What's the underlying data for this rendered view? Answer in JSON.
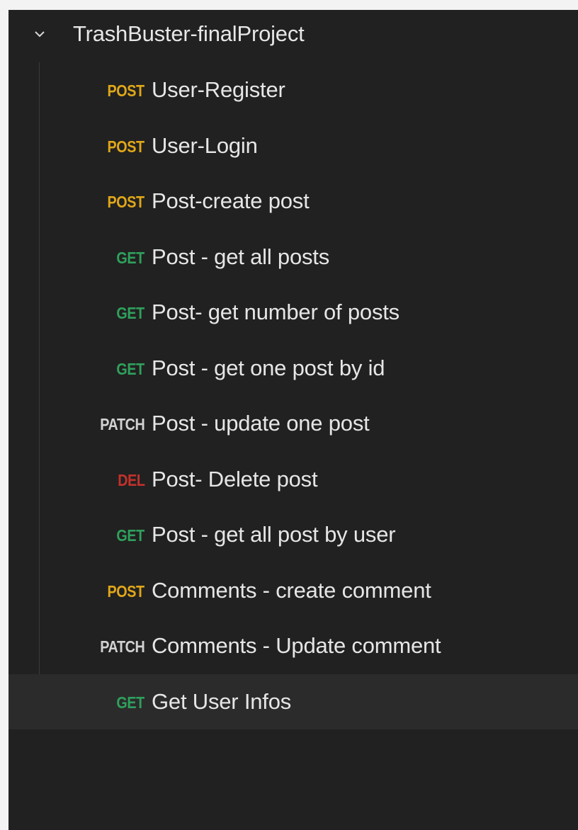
{
  "collection": {
    "name": "TrashBuster-finalProject",
    "expand_icon": "chevron-down-icon"
  },
  "requests": [
    {
      "method": "POST",
      "name": "User-Register"
    },
    {
      "method": "POST",
      "name": "User-Login"
    },
    {
      "method": "POST",
      "name": "Post-create post"
    },
    {
      "method": "GET",
      "name": "Post - get all posts"
    },
    {
      "method": "GET",
      "name": "Post- get number of posts"
    },
    {
      "method": "GET",
      "name": "Post - get one post by id"
    },
    {
      "method": "PATCH",
      "name": "Post - update one post"
    },
    {
      "method": "DEL",
      "name": "Post- Delete post"
    },
    {
      "method": "GET",
      "name": "Post - get all post by user"
    },
    {
      "method": "POST",
      "name": "Comments - create comment"
    },
    {
      "method": "PATCH",
      "name": "Comments - Update comment"
    },
    {
      "method": "GET",
      "name": "Get User Infos",
      "selected": true
    }
  ],
  "colors": {
    "background": "#212121",
    "text": "#e6e6e6",
    "post": "#e0a719",
    "get": "#2fa05c",
    "patch": "#d2d2d2",
    "delete": "#c2312b",
    "selected_row": "#2b2b2b"
  }
}
